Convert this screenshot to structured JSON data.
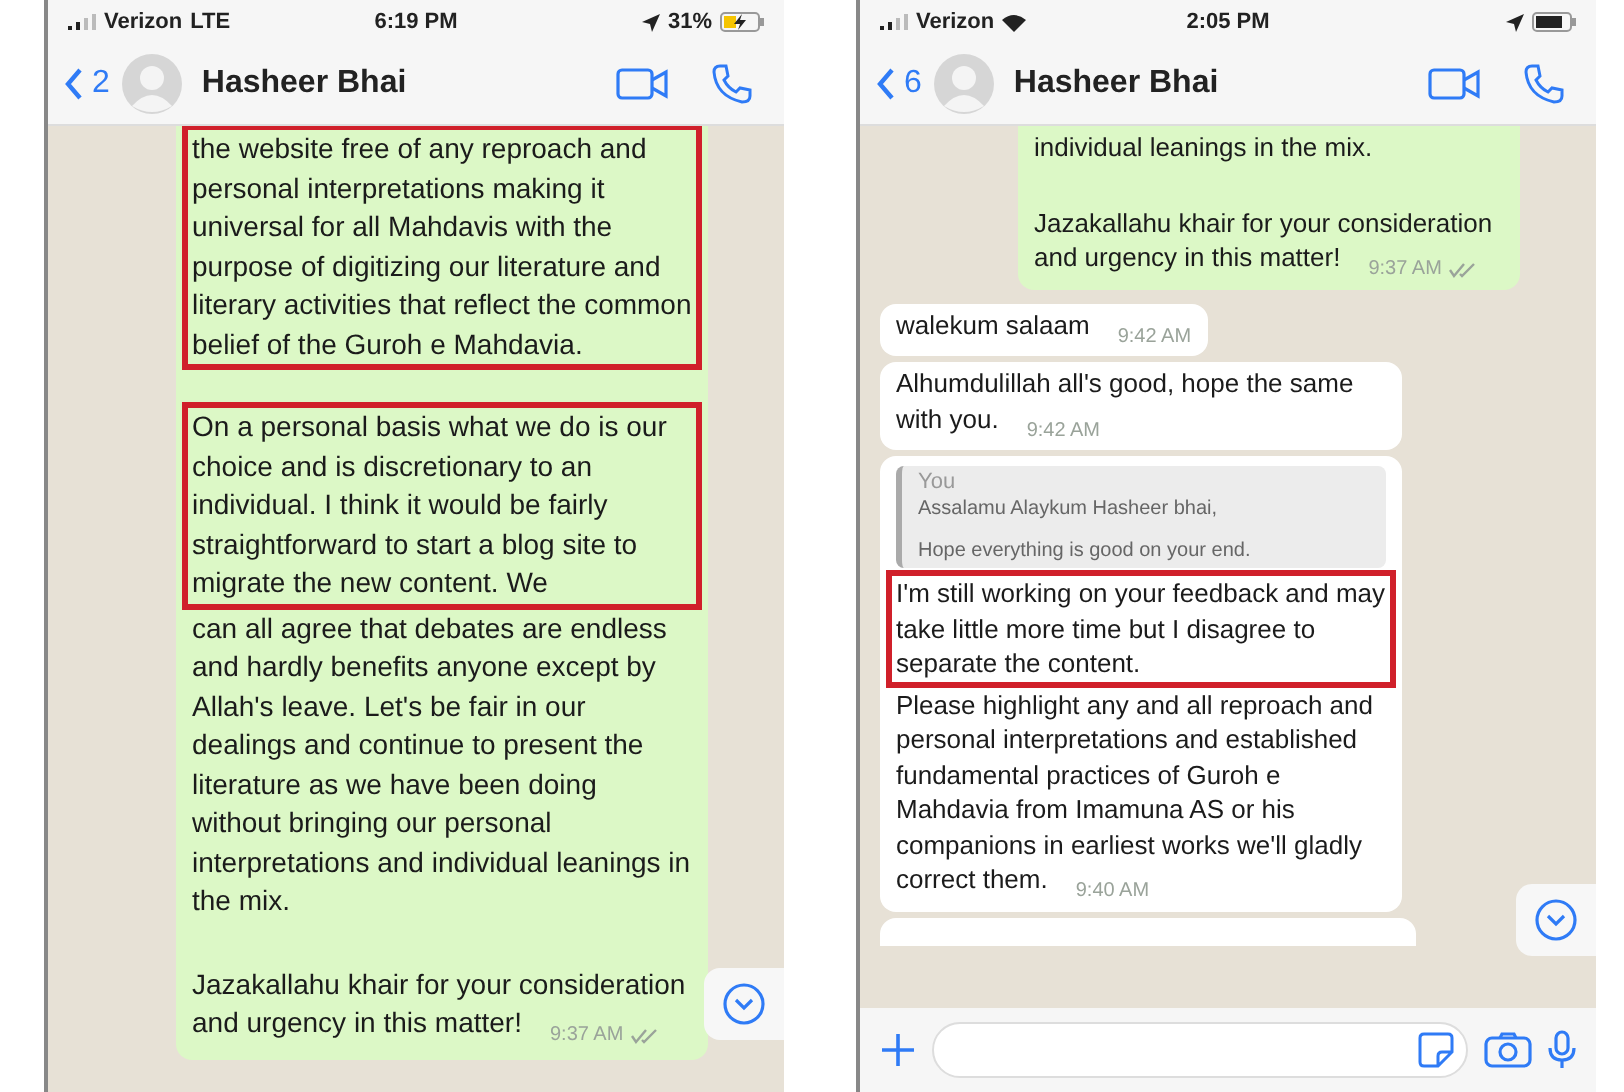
{
  "phones": [
    {
      "status": {
        "carrier": "Verizon",
        "network": "LTE",
        "time": "6:19 PM",
        "battery": "31%",
        "charging": true
      },
      "header": {
        "back_count": "2",
        "contact": "Hasheer Bhai"
      },
      "has_composer": false,
      "messages": [
        {
          "kind": "outgoing",
          "paragraphs": [
            [
              {
                "text": "the website free of any reproach and personal interpretations making it universal for all Mahdavis with the purpose of digitizing our literature and literary activities that reflect the common belief of the Guroh e Mahdavia.",
                "highlighted": true
              }
            ],
            [
              {
                "text": "On a personal basis what we do is our choice and is discretionary to an individual. I think it would be fairly straightforward to start a blog site to migrate the new content. We",
                "highlighted": true
              },
              {
                "text": "can all agree that debates are endless and hardly benefits anyone except by Allah's leave. Let's be fair in our dealings and continue to present the literature as we have been doing without bringing our personal interpretations and individual leanings in the mix.",
                "highlighted": false
              }
            ],
            [
              {
                "text": "Jazakallahu khair for your consideration and urgency in this matter!",
                "highlighted": false
              }
            ]
          ],
          "time": "9:37 AM"
        }
      ]
    },
    {
      "status": {
        "carrier": "Verizon",
        "time": "2:05 PM",
        "charging": false
      },
      "header": {
        "back_count": "6",
        "contact": "Hasheer Bhai"
      },
      "has_composer": true,
      "messages": [
        {
          "kind": "outgoing",
          "paragraphs": [
            [
              {
                "text": "individual leanings in the mix.",
                "highlighted": false
              }
            ],
            [
              {
                "text": "Jazakallahu khair for your consideration and urgency in this matter!",
                "highlighted": false
              }
            ]
          ],
          "time": "9:37 AM"
        },
        {
          "kind": "incoming",
          "paragraphs": [
            [
              {
                "text": "walekum salaam",
                "highlighted": false
              }
            ]
          ],
          "time": "9:42 AM"
        },
        {
          "kind": "incoming",
          "paragraphs": [
            [
              {
                "text": "Alhumdulillah all's good, hope the same with you.",
                "highlighted": false
              }
            ]
          ],
          "time": "9:42 AM"
        },
        {
          "kind": "reply",
          "quote": {
            "author": "You",
            "lines": [
              "Assalamu Alaykum Hasheer bhai,",
              "Hope everything is good on your end."
            ]
          },
          "paragraphs": [
            [
              {
                "text": "I'm still working on your feedback and may take little more time but I disagree to separate the content.",
                "highlighted": true
              },
              {
                "text": "Please highlight any and all reproach and personal interpretations and established fundamental practices of Guroh e Mahdavia from Imamuna AS or his companions in earliest works we'll gladly correct them.",
                "highlighted": false
              }
            ]
          ],
          "time": "9:40 AM"
        },
        {
          "kind": "cut"
        }
      ]
    }
  ]
}
